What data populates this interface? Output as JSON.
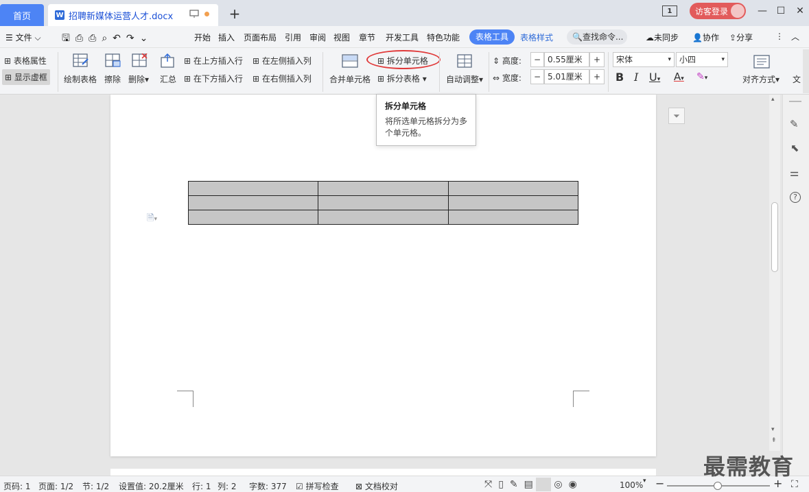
{
  "tabs": {
    "home": "首页",
    "document": "招聘新媒体运营人才.docx",
    "page_badge": "1",
    "login": "访客登录"
  },
  "menu": {
    "file": "文件",
    "items": [
      "开始",
      "插入",
      "页面布局",
      "引用",
      "审阅",
      "视图",
      "章节",
      "开发工具",
      "特色功能"
    ],
    "table_tools": "表格工具",
    "table_style": "表格样式",
    "search": "查找命令...",
    "not_synced": "未同步",
    "collaborate": "协作",
    "share": "分享"
  },
  "ribbon": {
    "table_props": "表格属性",
    "show_gridlines": "显示虚框",
    "draw_table": "绘制表格",
    "erase": "擦除",
    "delete": "删除",
    "summary": "汇总",
    "insert_row_above": "在上方插入行",
    "insert_row_below": "在下方插入行",
    "insert_col_left": "在左侧插入列",
    "insert_col_right": "在右侧插入列",
    "merge_cells": "合并单元格",
    "split_cells": "拆分单元格",
    "split_table": "拆分表格",
    "auto_fit": "自动调整",
    "height_label": "高度:",
    "height_value": "0.55厘米",
    "width_label": "宽度:",
    "width_value": "5.01厘米",
    "font_name": "宋体",
    "font_size": "小四",
    "align": "对齐方式",
    "text_dir": "文"
  },
  "tooltip": {
    "title": "拆分单元格",
    "desc": "将所选单元格拆分为多个单元格。"
  },
  "table": {
    "rows": 3,
    "cols": 3
  },
  "status": {
    "page": "页码: 1",
    "pages": "页面: 1/2",
    "section": "节: 1/2",
    "setting": "设置值: 20.2厘米",
    "row": "行: 1",
    "col": "列: 2",
    "words": "字数: 377",
    "spell": "拼写检查",
    "proof": "文档校对",
    "zoom": "100%"
  },
  "watermark": "最需教育",
  "colors": {
    "accent": "#4d84f5",
    "highlight": "#e03a3a",
    "cell": "#c6c6c6"
  }
}
